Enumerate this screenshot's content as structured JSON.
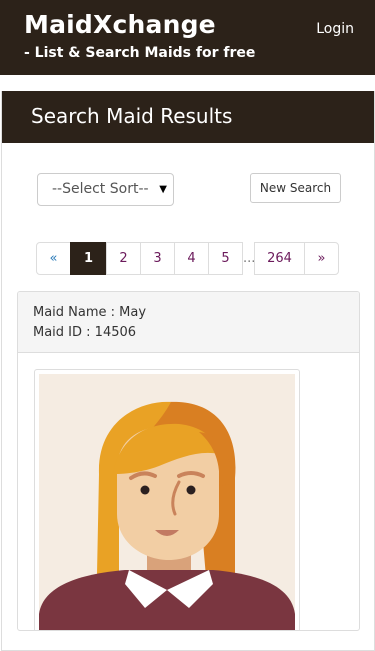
{
  "header": {
    "brand": "MaidXchange",
    "tagline": "- List & Search Maids for free",
    "login_label": "Login"
  },
  "panel": {
    "title": "Search Maid Results"
  },
  "controls": {
    "sort_selected": "--Select Sort--",
    "new_search_label": "New Search"
  },
  "pagination": {
    "prev": "«",
    "pages": [
      "1",
      "2",
      "3",
      "4",
      "5"
    ],
    "ellipsis": "...",
    "last_page": "264",
    "next": "»",
    "active_page": "1"
  },
  "result": {
    "name_line": "Maid Name : May",
    "id_line": "Maid ID : 14506",
    "photo_icon": "female-avatar-icon"
  },
  "colors": {
    "header_bg": "#2c2219",
    "pager_link": "#6b1a5b",
    "pager_prev": "#2a7ab8"
  }
}
